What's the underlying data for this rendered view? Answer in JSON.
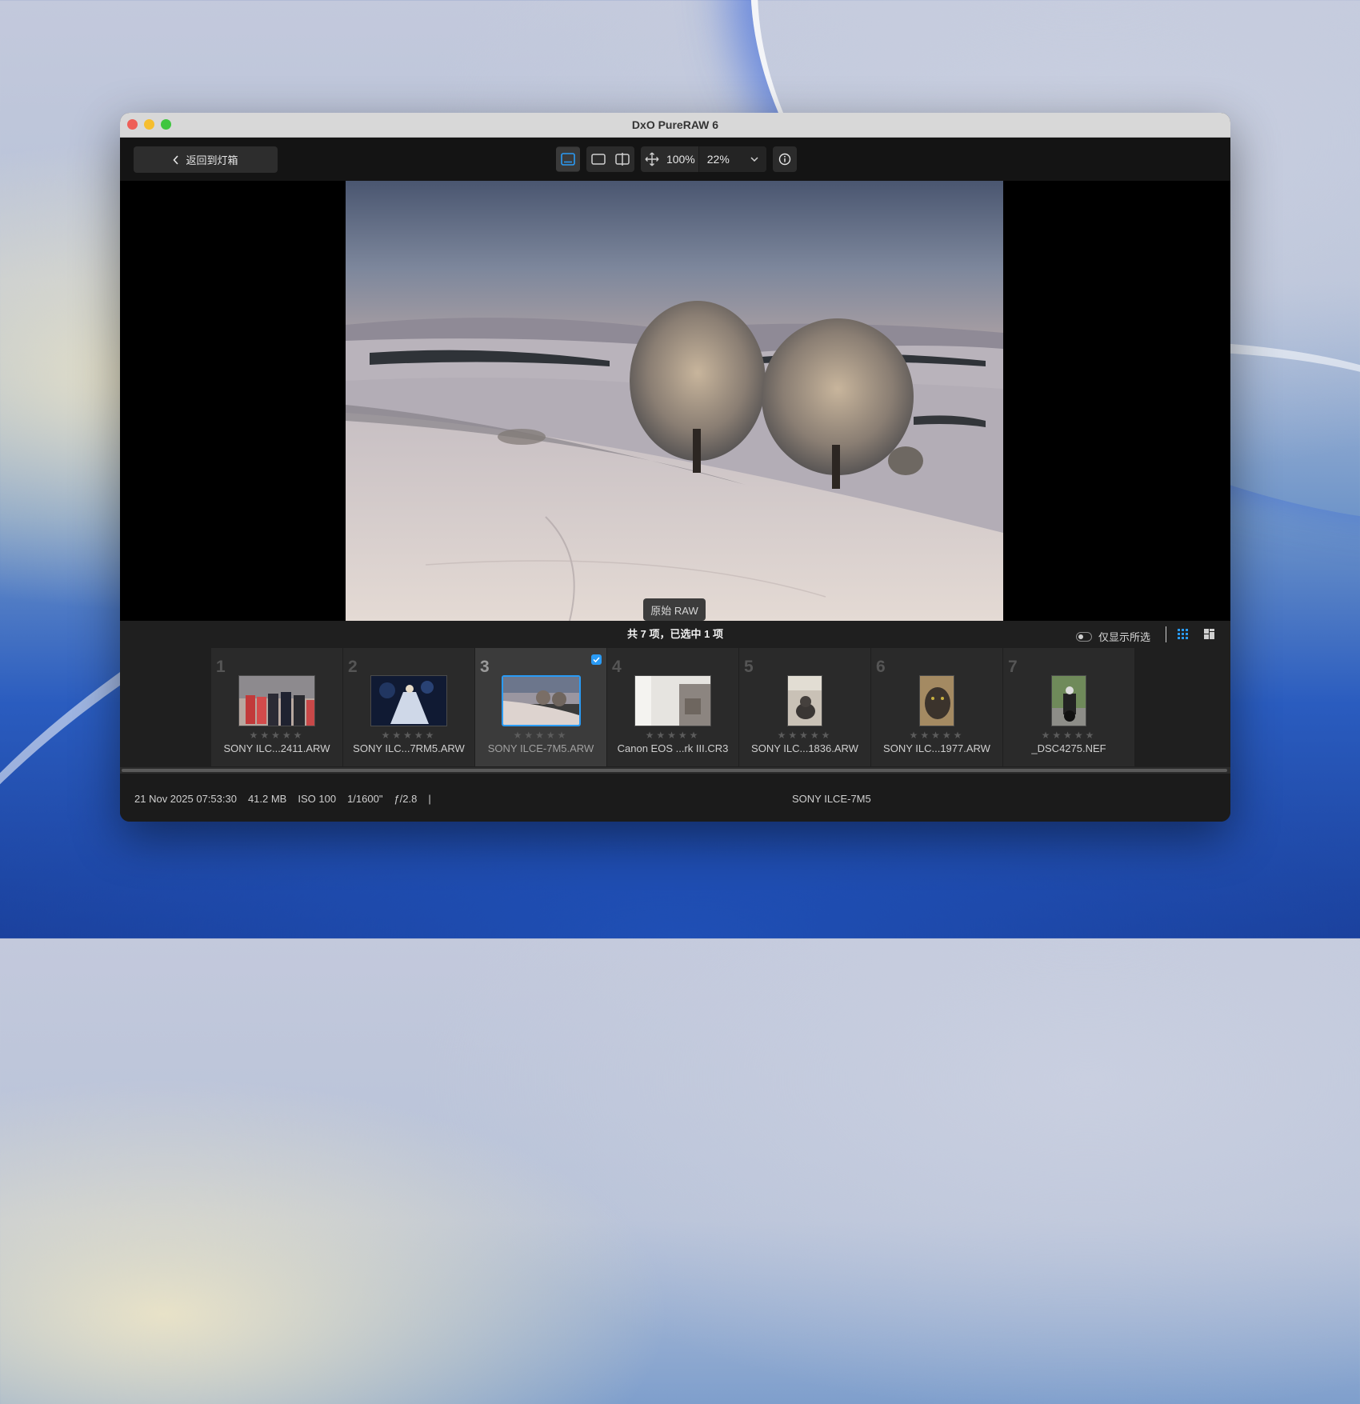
{
  "window": {
    "title": "DxO PureRAW 6"
  },
  "toolbar": {
    "back_label": "返回到灯箱",
    "zoom_fit": "100%",
    "zoom_select": "22%"
  },
  "viewer": {
    "badge": "原始 RAW"
  },
  "count_bar": {
    "summary": "共 7 项，已选中 1 项",
    "toggle_label": "仅显示所选"
  },
  "filmstrip": {
    "items": [
      {
        "number": "1",
        "name": "SONY ILC...2411.ARW",
        "stars": "★★★★★",
        "thumb": "portrait-group"
      },
      {
        "number": "2",
        "name": "SONY ILC...7RM5.ARW",
        "stars": "★★★★★",
        "thumb": "night-bride"
      },
      {
        "number": "3",
        "name": "SONY ILCE-7M5.ARW",
        "stars": "★★★★★",
        "thumb": "snow-landscape",
        "selected": true
      },
      {
        "number": "4",
        "name": "Canon EOS ...rk III.CR3",
        "stars": "★★★★★",
        "thumb": "interior"
      },
      {
        "number": "5",
        "name": "SONY ILC...1836.ARW",
        "stars": "★★★★★",
        "thumb": "cat"
      },
      {
        "number": "6",
        "name": "SONY ILC...1977.ARW",
        "stars": "★★★★★",
        "thumb": "cat-closeup"
      },
      {
        "number": "7",
        "name": "_DSC4275.NEF",
        "stars": "★★★★★",
        "thumb": "motorcycle"
      }
    ]
  },
  "status": {
    "date": "21 Nov 2025 07:53:30",
    "size": "41.2 MB",
    "iso": "ISO 100",
    "shutter": "1/1600\"",
    "aperture": "ƒ/2.8",
    "separator": "|",
    "camera": "SONY ILCE-7M5"
  },
  "colors": {
    "accent": "#2a9bf5"
  }
}
